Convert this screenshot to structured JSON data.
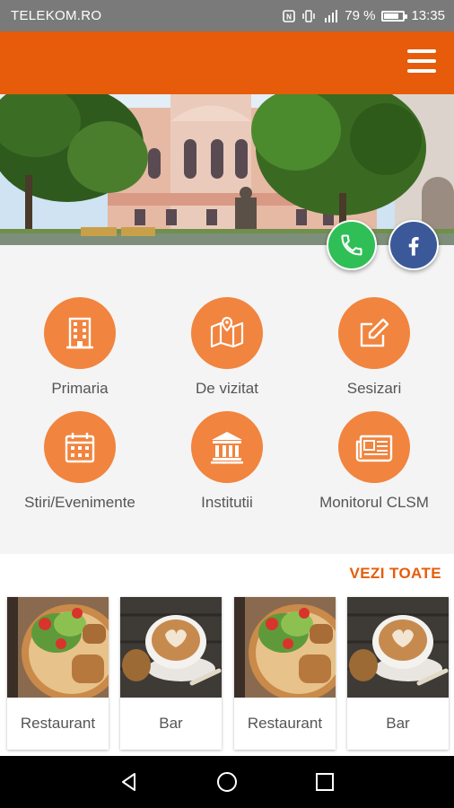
{
  "status_bar": {
    "carrier": "TELEKOM.RO",
    "battery_text": "79 %",
    "battery_level": 0.79,
    "time": "13:35"
  },
  "app_bar": {
    "menu_icon": "hamburger-menu-icon",
    "color": "#e65c0a"
  },
  "contact": {
    "phone_icon": "phone-icon",
    "facebook_icon": "facebook-icon"
  },
  "menu": [
    {
      "label": "Primaria",
      "icon": "building-icon"
    },
    {
      "label": "De vizitat",
      "icon": "map-icon"
    },
    {
      "label": "Sesizari",
      "icon": "edit-icon"
    },
    {
      "label": "Stiri/Evenimente",
      "icon": "calendar-icon"
    },
    {
      "label": "Institutii",
      "icon": "institution-icon"
    },
    {
      "label": "Monitorul CLSM",
      "icon": "newspaper-icon"
    }
  ],
  "places": {
    "see_all": "VEZI TOATE",
    "items": [
      {
        "label": "Restaurant"
      },
      {
        "label": "Bar"
      },
      {
        "label": "Restaurant"
      },
      {
        "label": "Bar"
      }
    ]
  },
  "nav": {
    "back": "back-icon",
    "home": "home-icon",
    "recents": "recents-icon"
  }
}
